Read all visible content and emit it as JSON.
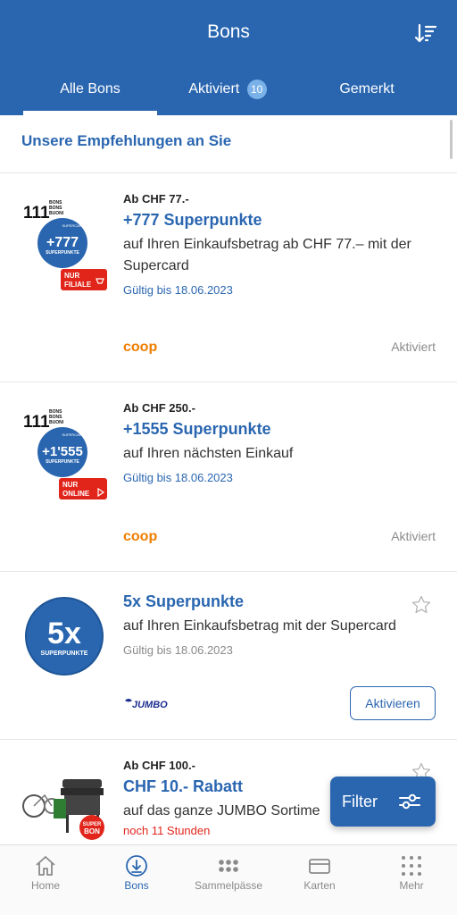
{
  "header": {
    "title": "Bons"
  },
  "tabs": [
    {
      "label": "Alle Bons"
    },
    {
      "label": "Aktiviert",
      "badge": "10"
    },
    {
      "label": "Gemerkt"
    }
  ],
  "section": {
    "heading": "Unsere Empfehlungen an Sie"
  },
  "cards": [
    {
      "pre": "Ab CHF 77.-",
      "title": "+777 Superpunkte",
      "desc": "auf Ihren Einkaufsbetrag ab CHF 77.– mit der Supercard",
      "valid": "Gültig bis 18.06.2023",
      "status": "Aktiviert",
      "brand": "coop",
      "img": {
        "brand_text": "111",
        "tag_lines": [
          "BONS",
          "BONS",
          "BUONI"
        ],
        "badge_top": "SUPERCARD",
        "badge_value": "+777",
        "badge_sub": "SUPERPUNKTE",
        "tag_line1": "NUR",
        "tag_line2": "FILIALE"
      }
    },
    {
      "pre": "Ab CHF 250.-",
      "title": "+1555 Superpunkte",
      "desc": "auf Ihren nächsten Einkauf",
      "valid": "Gültig bis 18.06.2023",
      "status": "Aktiviert",
      "brand": "coop",
      "img": {
        "brand_text": "111",
        "tag_lines": [
          "BONS",
          "BONS",
          "BUONI"
        ],
        "badge_top": "SUPERCARD",
        "badge_value": "+1'555",
        "badge_sub": "SUPERPUNKTE",
        "tag_line1": "NUR",
        "tag_line2": "ONLINE"
      }
    },
    {
      "title": "5x Superpunkte",
      "desc": "auf Ihren Einkaufsbetrag mit der Supercard",
      "valid": "Gültig bis 18.06.2023",
      "brand": "JUMBO",
      "activate_label": "Aktivieren",
      "img": {
        "value": "5x",
        "sub": "SUPERPUNKTE"
      }
    },
    {
      "pre": "Ab CHF 100.-",
      "title": "CHF 10.- Rabatt",
      "desc": "auf das ganze JUMBO Sortime",
      "note": "noch 11 Stunden",
      "img": {
        "badge_line1": "SUPER",
        "badge_line2": "BON"
      }
    }
  ],
  "filter": {
    "label": "Filter"
  },
  "nav": [
    {
      "label": "Home"
    },
    {
      "label": "Bons"
    },
    {
      "label": "Sammelpässe"
    },
    {
      "label": "Karten"
    },
    {
      "label": "Mehr"
    }
  ],
  "colors": {
    "primary": "#2A66B0",
    "coop": "#EF7D00",
    "jumbo": "#1B2E8F",
    "tag_red": "#E1251B"
  }
}
